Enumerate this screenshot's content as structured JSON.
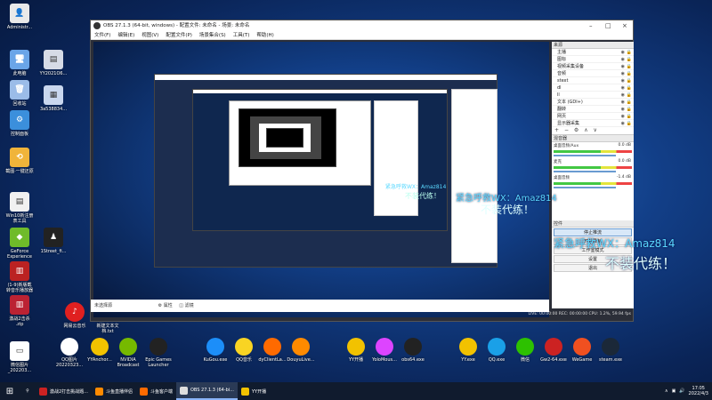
{
  "desktop_icons_left": [
    {
      "label": "Administr...",
      "color": "#e9e9e9",
      "glyph": "👤"
    },
    {
      "label": "YY2021O6...",
      "color": "#d6dbe6",
      "glyph": "▤"
    },
    {
      "label": "此电脑",
      "color": "#6aa5e8",
      "glyph": "🖥"
    },
    {
      "label": "回收站",
      "color": "#9bbce8",
      "glyph": "🗑"
    },
    {
      "label": "3a538834...",
      "color": "#c9d7ee",
      "glyph": "▦"
    },
    {
      "label": "控制面板",
      "color": "#3b8fdc",
      "glyph": "⚙"
    },
    {
      "label": "截图·一键还原",
      "color": "#f0b43a",
      "glyph": "⟲"
    },
    {
      "label": "Win10新注册\n表工具",
      "color": "#f1f1f1",
      "glyph": "▤"
    },
    {
      "label": "GeForce\nExperience",
      "color": "#6fbb2a",
      "glyph": "◆"
    },
    {
      "label": "1Street_fi...",
      "color": "#222",
      "glyph": "♟"
    },
    {
      "label": "(1-9)新版截\n转音乐播放器",
      "color": "#b22",
      "glyph": "▥"
    },
    {
      "label": "激战2击杀\n.zip",
      "color": "#b23",
      "glyph": "▥"
    },
    {
      "label": "微信图片\n_202203...",
      "color": "#fff",
      "glyph": "▭"
    }
  ],
  "desktop_icons_bottom": [
    {
      "label": "QQ图片\n20220323...",
      "color": "#fff"
    },
    {
      "label": "YYAnchor...",
      "color": "#f2c200"
    },
    {
      "label": "NVIDIA\nBroadcast",
      "color": "#76b900"
    },
    {
      "label": "Epic Games\nLauncher",
      "color": "#222"
    },
    {
      "label": "KuGou.exe",
      "color": "#1c8ef9"
    },
    {
      "label": "QQ音乐",
      "color": "#f9d423"
    },
    {
      "label": "dyClientLa...",
      "color": "#ff6a00"
    },
    {
      "label": "DouyuLive...",
      "color": "#ff8a00"
    },
    {
      "label": "YY开播",
      "color": "#f2c200"
    },
    {
      "label": "YoloMous...",
      "color": "#d4f"
    },
    {
      "label": "obs64.exe",
      "color": "#222"
    },
    {
      "label": "YY.exe",
      "color": "#f2c200"
    },
    {
      "label": "QQ.exe",
      "color": "#1aa0e8"
    },
    {
      "label": "微信",
      "color": "#2dc100"
    },
    {
      "label": "Gw2-64.exe",
      "color": "#c22"
    },
    {
      "label": "WeGame",
      "color": "#f05020"
    },
    {
      "label": "steam.exe",
      "color": "#1b2838"
    }
  ],
  "desktop_icon_netease": {
    "label": "网易云音乐",
    "color": "#e02020"
  },
  "desktop_icon_newtext": {
    "label": "新建文本文\n档.txt",
    "color": "#f4f4f4"
  },
  "obs": {
    "title": "OBS 27.1.3 (64-bit, windows) - 配置文件: 未命名 - 场景: 未命名",
    "menu": [
      "文件(F)",
      "编辑(E)",
      "视图(V)",
      "配置文件(P)",
      "场景集合(S)",
      "工具(T)",
      "帮助(H)"
    ],
    "sources_header": "来源",
    "sources": [
      "主播",
      "图标",
      "视频采集设备",
      "音频",
      "stext",
      "dl",
      "ll",
      "文本 (GDI+)",
      "翻转",
      "网页",
      "显示器采集"
    ],
    "mixer_header": "混音器",
    "mixer": [
      {
        "name": "桌面音频/Aux",
        "level": "0.0 dB"
      },
      {
        "name": "麦克",
        "level": "0.0 dB"
      },
      {
        "name": "桌面音频",
        "level": "-1.4 dB"
      }
    ],
    "controls_header": "控件",
    "controls": [
      "停止推流",
      "开始录制",
      "工作室模式",
      "设置",
      "退出"
    ],
    "scene_label": "未选择源",
    "scene_buttons": [
      "属性",
      "滤镜"
    ],
    "status": "LIVE: 00:00:00  REC: 00:00:00  CPU: 1.2%, 59.94 fps"
  },
  "watermark": {
    "line1": "紧急呼救WX：Amaz814",
    "line2": "不装代练！"
  },
  "taskbar": {
    "search_placeholder": "搜索",
    "apps": [
      {
        "label": "激战2打击挑战题...",
        "color": "#c22",
        "active": false
      },
      {
        "label": "斗鱼直播伴侣",
        "color": "#ff8a00",
        "active": false
      },
      {
        "label": "斗鱼客户端",
        "color": "#ff6a00",
        "active": false
      },
      {
        "label": "OBS 27.1.3 (64-bi...",
        "color": "#ddd",
        "active": true
      },
      {
        "label": "YY开播",
        "color": "#f2c200",
        "active": false
      }
    ],
    "time": "17:05",
    "date": "2022/4/3"
  },
  "colors": {
    "accent": "#5bd9ff",
    "desktop": "#123f88"
  }
}
